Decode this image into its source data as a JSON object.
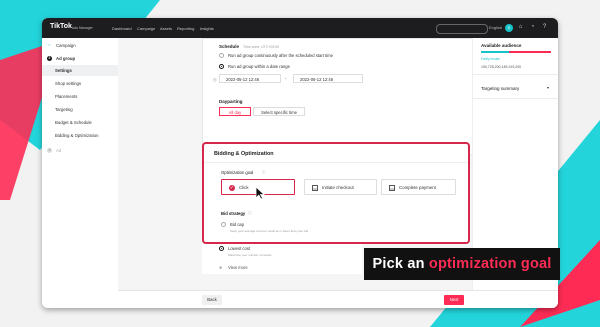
{
  "topbar": {
    "logo": "TikTok",
    "logo_sub": "Ads Manager",
    "nav": [
      "Dashboard",
      "Campaign",
      "Assets",
      "Reporting",
      "Insights"
    ],
    "lang": "English",
    "avatar_letter": "S"
  },
  "sidebar": {
    "items": [
      {
        "label": "Campaign",
        "done": true
      },
      {
        "label": "Ad group",
        "step": "2"
      },
      {
        "label": "Settings",
        "active": true
      },
      {
        "label": "Shop settings"
      },
      {
        "label": "Placements"
      },
      {
        "label": "Targeting"
      },
      {
        "label": "Budget & Schedule"
      },
      {
        "label": "Bidding & Optimization"
      },
      {
        "label": "Ad",
        "step": "3"
      }
    ]
  },
  "schedule": {
    "label": "Schedule",
    "hint": "Time zone: UTC+00:00",
    "option1": "Run ad group continuously after the scheduled start time",
    "option2": "Run ad group within a date range",
    "start": "2022-05-12 12:46",
    "end": "2022-06-12 12:46",
    "separator": "-"
  },
  "dayparting": {
    "label": "Dayparting",
    "all_day": "All day",
    "specific": "Select specific time"
  },
  "bidding": {
    "title": "Bidding & Optimization",
    "goal_label": "Optimization goal",
    "goals": [
      "Click",
      "Initiate checkout",
      "Complete payment"
    ],
    "bid_label": "Bid strategy",
    "bid_cap": "Bid cap",
    "bid_cap_hint": "Keep your average cost per result at or lower than your bid",
    "lowest": "Lowest cost",
    "lowest_hint": "Maximize your number of results",
    "view_more": "View more"
  },
  "footer": {
    "back": "Back",
    "next": "Next"
  },
  "right_panel": {
    "audience_title": "Available audience",
    "audience_status": "Fairly broad",
    "audience_range": "150,725,200-183,919,200",
    "targeting_summary": "Targeting summary"
  },
  "caption": {
    "prefix": "Pick an ",
    "accent": "optimization goal"
  },
  "colors": {
    "accent": "#fe2c55",
    "highlight": "#d6264a",
    "teal": "#19c2c9"
  }
}
